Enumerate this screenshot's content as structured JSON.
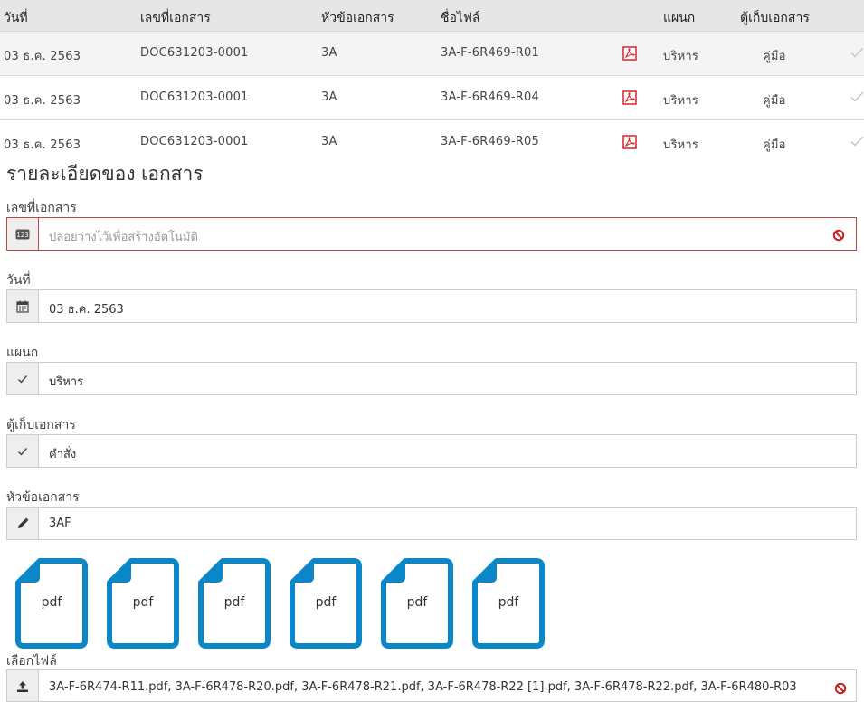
{
  "table": {
    "headers": [
      "วันที่",
      "เลขที่เอกสาร",
      "หัวข้อเอกสาร",
      "ชื่อไฟล์",
      "แผนก",
      "ตู้เก็บเอกสาร"
    ],
    "rows": [
      {
        "date": "03 ธ.ค. 2563",
        "doc_no": "DOC631203-0001",
        "subject": "3A",
        "file": "3A-F-6R469-R01",
        "dept": "บริหาร",
        "cabinet": "คู่มือ"
      },
      {
        "date": "03 ธ.ค. 2563",
        "doc_no": "DOC631203-0001",
        "subject": "3A",
        "file": "3A-F-6R469-R04",
        "dept": "บริหาร",
        "cabinet": "คู่มือ"
      },
      {
        "date": "03 ธ.ค. 2563",
        "doc_no": "DOC631203-0001",
        "subject": "3A",
        "file": "3A-F-6R469-R05",
        "dept": "บริหาร",
        "cabinet": "คู่มือ"
      }
    ]
  },
  "detail": {
    "title": "รายละเอียดของ เอกสาร",
    "doc_no_label": "เลขที่เอกสาร",
    "doc_no_placeholder": "ปล่อยว่างไว้เพื่อสร้างอัตโนมัติ",
    "date_label": "วันที่",
    "date_value": "03 ธ.ค. 2563",
    "dept_label": "แผนก",
    "dept_value": "บริหาร",
    "cabinet_label": "ตู้เก็บเอกสาร",
    "cabinet_value": "คำสั่ง",
    "subject_label": "หัวข้อเอกสาร",
    "subject_value": "3AF",
    "files_ext": [
      "pdf",
      "pdf",
      "pdf",
      "pdf",
      "pdf",
      "pdf"
    ],
    "choose_file_label": "เลือกไฟล์",
    "choose_file_value": "3A-F-6R474-R11.pdf, 3A-F-6R478-R20.pdf, 3A-F-6R478-R21.pdf, 3A-F-6R478-R22 [1].pdf, 3A-F-6R478-R22.pdf, 3A-F-6R480-R03"
  },
  "icons": {
    "number_addon": "123-icon",
    "date_addon": "calendar-icon",
    "dept_addon": "check-icon",
    "cabinet_addon": "check-icon",
    "subject_addon": "pencil-icon",
    "file_addon": "upload-icon",
    "clear": "ban-icon",
    "row_file": "pdf-icon",
    "row_action": "check-icon"
  },
  "colors": {
    "header_bg": "#e6e6e6",
    "error_border": "#b94a48",
    "clear_red": "#cc1f1f",
    "pdf_red": "#d9232d",
    "file_blue": "#0a86c9"
  }
}
